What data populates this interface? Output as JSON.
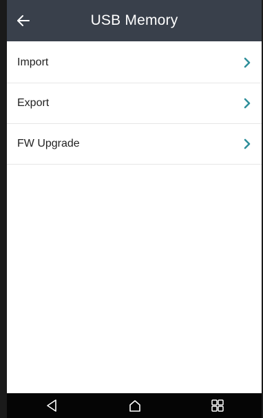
{
  "header": {
    "title": "USB Memory",
    "back_icon": "arrow-left-icon",
    "background": "#39404b"
  },
  "menu": {
    "items": [
      {
        "label": "Import",
        "icon": "chevron-right-icon"
      },
      {
        "label": "Export",
        "icon": "chevron-right-icon"
      },
      {
        "label": "FW Upgrade",
        "icon": "chevron-right-icon"
      }
    ],
    "accent": "#2f8f9a"
  },
  "navbar": {
    "buttons": [
      "back-triangle-icon",
      "home-icon",
      "recents-icon"
    ]
  }
}
